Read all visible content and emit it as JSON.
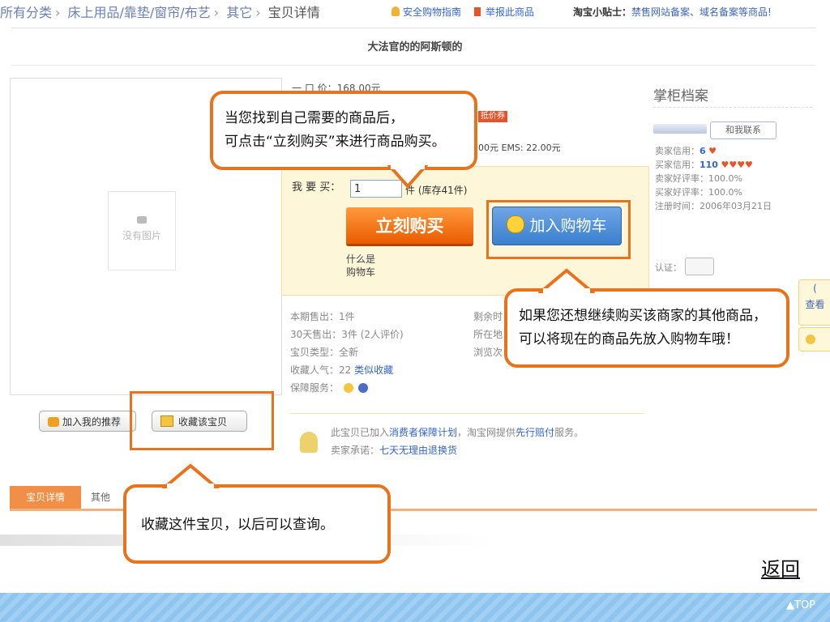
{
  "breadcrumb": {
    "items": [
      "所有分类",
      "床上用品/靠垫/窗帘/布艺",
      "其它"
    ],
    "current": "宝贝详情"
  },
  "header": {
    "safe_guide": "安全购物指南",
    "report": "举报此商品",
    "tips_label": "淘宝小贴士：",
    "tips_text": "禁售网站备案、域名备案等商品!"
  },
  "shop_title": "大法官的的阿斯顿的",
  "image_box": {
    "no_image": "没有图片",
    "recommend_button": "加入我的推荐",
    "favorite_button": "收藏该宝贝"
  },
  "price": {
    "label": "一 口 价：",
    "value": "168.00元",
    "coupon": "抵价券",
    "shipping": "00元 EMS: 22.00元"
  },
  "buy": {
    "want_label": "我 要 买：",
    "quantity": "1",
    "stock": "件 (库存41件)",
    "buy_now": "立刻购买",
    "add_to_cart": "加入购物车",
    "what_is_cart_1": "什么是",
    "what_is_cart_2": "购物车"
  },
  "stats": {
    "sold_period": "本期售出：1件",
    "sold_30": "30天售出：3件 (2人评价)",
    "type": "宝贝类型：全新",
    "popularity": "收藏人气：22",
    "similar": "类似收藏",
    "service": "保障服务：",
    "right_col": [
      "剩余时",
      "所在地",
      "浏览次"
    ]
  },
  "guarantee": {
    "line1_prefix": "此宝贝已加入",
    "line1_link": "消费者保障计划",
    "line1_mid": "，淘宝网提供",
    "line1_link2": "先行赔付",
    "line1_suffix": "服务。",
    "line2_label": "卖家承诺：",
    "line2_link": "七天无理由退换货"
  },
  "seller": {
    "title": "掌柜档案",
    "contact": "和我联系",
    "seller_credit_label": "卖家信用：",
    "seller_credit": "6",
    "buyer_credit_label": "买家信用：",
    "buyer_credit": "110",
    "seller_rate_label": "卖家好评率：",
    "seller_rate": "100.0%",
    "buyer_rate_label": "买家好评率：",
    "buyer_rate": "100.0%",
    "reg_label": "注册时间：",
    "reg_date": "2006年03月21日",
    "cert_label": "认证："
  },
  "side_float": {
    "line1": "(",
    "line2": "查看"
  },
  "tabs": {
    "tab1": "宝贝详情",
    "tab2": "其他"
  },
  "callouts": {
    "buy_line1": "当您找到自己需要的商品后，",
    "buy_line2": "可点击“立刻购买”来进行商品购买。",
    "cart_line1": "如果您还想继续购买该商家的其他商品，",
    "cart_line2": "可以将现在的商品先放入购物车哦！",
    "fav_line": "收藏这件宝贝，以后可以查询。"
  },
  "nav": {
    "back": "返回",
    "top": "▲TOP"
  }
}
